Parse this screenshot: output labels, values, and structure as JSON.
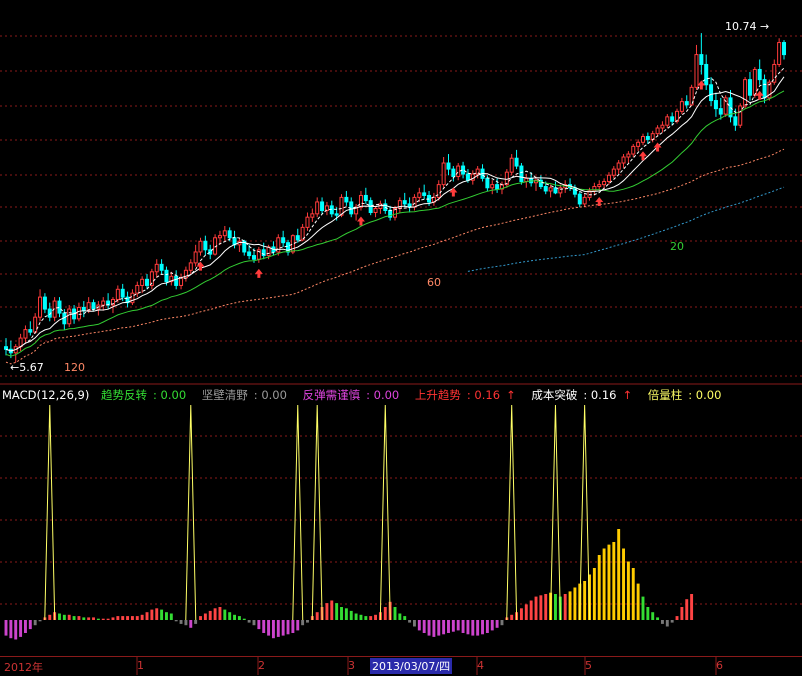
{
  "legend": {
    "title": "MACD(12,26,9)",
    "items": [
      {
        "label": "趋势反转",
        "value": "0.00",
        "color": "#33dd33",
        "arrow": ""
      },
      {
        "label": "坚壁清野",
        "value": "0.00",
        "color": "#9a9a9a",
        "arrow": ""
      },
      {
        "label": "反弹需谨慎",
        "value": "0.00",
        "color": "#dd44dd",
        "arrow": ""
      },
      {
        "label": "上升趋势",
        "value": "0.16",
        "color": "#ff3333",
        "arrow": "↑"
      },
      {
        "label": "成本突破",
        "value": "0.16",
        "color": "#ffffff",
        "arrow": "↑"
      },
      {
        "label": "倍量柱",
        "value": "0.00",
        "color": "#ffff66",
        "arrow": ""
      }
    ]
  },
  "price_labels": {
    "high": "10.74",
    "low": "5.67"
  },
  "ma_labels": {
    "ma20": "20",
    "ma60": "60",
    "ma120": "120"
  },
  "x_axis": {
    "labels": [
      "2012年",
      "1",
      "2",
      "3",
      "4",
      "5",
      "6"
    ],
    "selected_date": "2013/03/07/四"
  },
  "colors": {
    "up": "#ff3b3b",
    "down": "#00ffff",
    "ma5": "#ffffff",
    "ma10": "#ffffff",
    "ma20": "#33cc33",
    "ma60": "#ff8866",
    "ma120": "#3399cc",
    "spike": "#ffff66",
    "hist_red": "#ff4444",
    "hist_green": "#33dd33",
    "hist_gold": "#ffcc00",
    "hist_purple": "#cc44cc",
    "hist_gray": "#777777",
    "grid": "#8a1a1a"
  },
  "chart_data": {
    "type": "candlestick",
    "price_scale": "log",
    "price_range": [
      5.5,
      11.4
    ],
    "candles": [
      [
        5.85,
        5.95,
        5.75,
        5.82
      ],
      [
        5.82,
        5.92,
        5.72,
        5.78
      ],
      [
        5.78,
        5.88,
        5.67,
        5.85
      ],
      [
        5.85,
        6.0,
        5.8,
        5.95
      ],
      [
        5.95,
        6.1,
        5.9,
        6.05
      ],
      [
        6.05,
        6.15,
        5.98,
        6.02
      ],
      [
        6.02,
        6.25,
        6.0,
        6.2
      ],
      [
        6.2,
        6.55,
        6.15,
        6.45
      ],
      [
        6.45,
        6.5,
        6.25,
        6.3
      ],
      [
        6.3,
        6.38,
        6.15,
        6.2
      ],
      [
        6.2,
        6.45,
        6.15,
        6.4
      ],
      [
        6.4,
        6.45,
        6.2,
        6.25
      ],
      [
        6.25,
        6.3,
        6.05,
        6.12
      ],
      [
        6.12,
        6.35,
        6.08,
        6.3
      ],
      [
        6.3,
        6.35,
        6.12,
        6.18
      ],
      [
        6.18,
        6.38,
        6.15,
        6.32
      ],
      [
        6.32,
        6.4,
        6.2,
        6.28
      ],
      [
        6.28,
        6.45,
        6.25,
        6.38
      ],
      [
        6.38,
        6.42,
        6.28,
        6.3
      ],
      [
        6.3,
        6.4,
        6.22,
        6.35
      ],
      [
        6.35,
        6.45,
        6.28,
        6.4
      ],
      [
        6.4,
        6.5,
        6.3,
        6.35
      ],
      [
        6.35,
        6.45,
        6.25,
        6.42
      ],
      [
        6.42,
        6.6,
        6.38,
        6.55
      ],
      [
        6.55,
        6.62,
        6.4,
        6.45
      ],
      [
        6.45,
        6.52,
        6.32,
        6.38
      ],
      [
        6.38,
        6.55,
        6.35,
        6.5
      ],
      [
        6.5,
        6.65,
        6.45,
        6.6
      ],
      [
        6.6,
        6.72,
        6.5,
        6.68
      ],
      [
        6.68,
        6.75,
        6.55,
        6.6
      ],
      [
        6.6,
        6.82,
        6.55,
        6.78
      ],
      [
        6.78,
        6.95,
        6.7,
        6.88
      ],
      [
        6.88,
        6.95,
        6.75,
        6.8
      ],
      [
        6.8,
        6.85,
        6.6,
        6.65
      ],
      [
        6.65,
        6.78,
        6.6,
        6.72
      ],
      [
        6.72,
        6.8,
        6.55,
        6.6
      ],
      [
        6.6,
        6.75,
        6.55,
        6.7
      ],
      [
        6.7,
        6.85,
        6.65,
        6.8
      ],
      [
        6.8,
        6.95,
        6.75,
        6.9
      ],
      [
        6.9,
        7.15,
        6.85,
        7.05
      ],
      [
        7.05,
        7.25,
        7.0,
        7.2
      ],
      [
        7.2,
        7.28,
        7.0,
        7.08
      ],
      [
        7.08,
        7.15,
        6.95,
        7.02
      ],
      [
        7.02,
        7.3,
        7.0,
        7.25
      ],
      [
        7.25,
        7.35,
        7.15,
        7.28
      ],
      [
        7.28,
        7.42,
        7.2,
        7.35
      ],
      [
        7.35,
        7.4,
        7.2,
        7.25
      ],
      [
        7.25,
        7.35,
        7.1,
        7.15
      ],
      [
        7.15,
        7.25,
        7.05,
        7.2
      ],
      [
        7.2,
        7.22,
        7.0,
        7.05
      ],
      [
        7.05,
        7.15,
        6.95,
        7.0
      ],
      [
        7.0,
        7.1,
        6.9,
        6.95
      ],
      [
        6.95,
        7.12,
        6.9,
        7.08
      ],
      [
        7.08,
        7.18,
        6.95,
        7.0
      ],
      [
        7.0,
        7.15,
        6.95,
        7.12
      ],
      [
        7.12,
        7.2,
        7.0,
        7.05
      ],
      [
        7.05,
        7.3,
        7.0,
        7.25
      ],
      [
        7.25,
        7.35,
        7.12,
        7.18
      ],
      [
        7.18,
        7.22,
        7.0,
        7.05
      ],
      [
        7.05,
        7.3,
        7.02,
        7.28
      ],
      [
        7.28,
        7.38,
        7.18,
        7.22
      ],
      [
        7.22,
        7.45,
        7.2,
        7.4
      ],
      [
        7.4,
        7.62,
        7.35,
        7.55
      ],
      [
        7.55,
        7.68,
        7.48,
        7.6
      ],
      [
        7.6,
        7.85,
        7.55,
        7.78
      ],
      [
        7.78,
        7.85,
        7.6,
        7.65
      ],
      [
        7.65,
        7.78,
        7.58,
        7.72
      ],
      [
        7.72,
        7.8,
        7.55,
        7.6
      ],
      [
        7.6,
        7.7,
        7.5,
        7.58
      ],
      [
        7.58,
        7.9,
        7.55,
        7.85
      ],
      [
        7.85,
        7.95,
        7.72,
        7.78
      ],
      [
        7.78,
        7.85,
        7.55,
        7.6
      ],
      [
        7.6,
        7.75,
        7.5,
        7.7
      ],
      [
        7.7,
        7.95,
        7.65,
        7.88
      ],
      [
        7.88,
        8.0,
        7.75,
        7.8
      ],
      [
        7.8,
        7.85,
        7.58,
        7.62
      ],
      [
        7.62,
        7.72,
        7.55,
        7.68
      ],
      [
        7.68,
        7.8,
        7.6,
        7.75
      ],
      [
        7.75,
        7.82,
        7.6,
        7.65
      ],
      [
        7.65,
        7.72,
        7.5,
        7.55
      ],
      [
        7.55,
        7.72,
        7.5,
        7.68
      ],
      [
        7.68,
        7.85,
        7.62,
        7.8
      ],
      [
        7.8,
        7.92,
        7.7,
        7.75
      ],
      [
        7.75,
        7.85,
        7.62,
        7.7
      ],
      [
        7.7,
        7.9,
        7.65,
        7.85
      ],
      [
        7.85,
        8.0,
        7.78,
        7.92
      ],
      [
        7.92,
        8.05,
        7.82,
        7.88
      ],
      [
        7.88,
        7.95,
        7.72,
        7.78
      ],
      [
        7.78,
        7.92,
        7.72,
        7.85
      ],
      [
        7.85,
        8.12,
        7.8,
        8.05
      ],
      [
        8.05,
        8.5,
        8.0,
        8.4
      ],
      [
        8.4,
        8.55,
        8.2,
        8.3
      ],
      [
        8.3,
        8.35,
        8.1,
        8.18
      ],
      [
        8.18,
        8.4,
        8.12,
        8.35
      ],
      [
        8.35,
        8.42,
        8.15,
        8.22
      ],
      [
        8.22,
        8.3,
        8.08,
        8.12
      ],
      [
        8.12,
        8.28,
        8.05,
        8.22
      ],
      [
        8.22,
        8.35,
        8.15,
        8.3
      ],
      [
        8.3,
        8.38,
        8.1,
        8.15
      ],
      [
        8.15,
        8.2,
        7.95,
        8.0
      ],
      [
        8.0,
        8.12,
        7.9,
        8.05
      ],
      [
        8.05,
        8.15,
        7.92,
        7.98
      ],
      [
        7.98,
        8.1,
        7.9,
        8.05
      ],
      [
        8.05,
        8.3,
        8.0,
        8.25
      ],
      [
        8.25,
        8.55,
        8.2,
        8.48
      ],
      [
        8.48,
        8.62,
        8.3,
        8.35
      ],
      [
        8.35,
        8.4,
        8.05,
        8.1
      ],
      [
        8.1,
        8.22,
        8.0,
        8.15
      ],
      [
        8.15,
        8.25,
        8.02,
        8.08
      ],
      [
        8.08,
        8.18,
        7.95,
        8.12
      ],
      [
        8.12,
        8.2,
        7.98,
        8.02
      ],
      [
        8.02,
        8.1,
        7.9,
        7.95
      ],
      [
        7.95,
        8.05,
        7.85,
        8.0
      ],
      [
        8.0,
        8.1,
        7.9,
        7.92
      ],
      [
        7.92,
        8.05,
        7.85,
        8.0
      ],
      [
        8.0,
        8.12,
        7.92,
        8.05
      ],
      [
        8.05,
        8.15,
        7.95,
        8.0
      ],
      [
        8.0,
        8.05,
        7.85,
        7.9
      ],
      [
        7.9,
        7.95,
        7.7,
        7.75
      ],
      [
        7.75,
        7.9,
        7.7,
        7.85
      ],
      [
        7.85,
        8.0,
        7.8,
        7.95
      ],
      [
        7.95,
        8.08,
        7.88,
        8.02
      ],
      [
        8.02,
        8.12,
        7.95,
        8.05
      ],
      [
        8.05,
        8.15,
        7.98,
        8.1
      ],
      [
        8.1,
        8.25,
        8.05,
        8.2
      ],
      [
        8.2,
        8.35,
        8.15,
        8.3
      ],
      [
        8.3,
        8.45,
        8.22,
        8.4
      ],
      [
        8.4,
        8.55,
        8.32,
        8.5
      ],
      [
        8.5,
        8.6,
        8.4,
        8.55
      ],
      [
        8.55,
        8.72,
        8.5,
        8.68
      ],
      [
        8.68,
        8.8,
        8.6,
        8.75
      ],
      [
        8.75,
        8.9,
        8.7,
        8.85
      ],
      [
        8.85,
        8.92,
        8.72,
        8.8
      ],
      [
        8.8,
        8.95,
        8.75,
        8.9
      ],
      [
        8.9,
        9.05,
        8.85,
        9.0
      ],
      [
        9.0,
        9.12,
        8.92,
        9.05
      ],
      [
        9.05,
        9.25,
        9.0,
        9.2
      ],
      [
        9.2,
        9.28,
        9.05,
        9.12
      ],
      [
        9.12,
        9.35,
        9.08,
        9.3
      ],
      [
        9.3,
        9.55,
        9.25,
        9.48
      ],
      [
        9.48,
        9.6,
        9.35,
        9.42
      ],
      [
        9.42,
        9.8,
        9.4,
        9.75
      ],
      [
        9.75,
        10.6,
        9.7,
        10.4
      ],
      [
        10.4,
        10.85,
        10.0,
        10.2
      ],
      [
        10.2,
        10.4,
        9.7,
        9.8
      ],
      [
        9.8,
        9.95,
        9.4,
        9.5
      ],
      [
        9.5,
        9.65,
        9.2,
        9.35
      ],
      [
        9.35,
        9.55,
        9.15,
        9.25
      ],
      [
        9.25,
        9.6,
        9.2,
        9.55
      ],
      [
        9.55,
        9.7,
        9.1,
        9.2
      ],
      [
        9.2,
        9.35,
        8.95,
        9.05
      ],
      [
        9.05,
        9.45,
        9.0,
        9.4
      ],
      [
        9.4,
        9.95,
        9.35,
        9.9
      ],
      [
        9.9,
        10.05,
        9.5,
        9.6
      ],
      [
        9.6,
        10.15,
        9.55,
        10.1
      ],
      [
        10.1,
        10.3,
        9.8,
        9.9
      ],
      [
        9.9,
        10.0,
        9.45,
        9.55
      ],
      [
        9.55,
        9.9,
        9.5,
        9.85
      ],
      [
        9.85,
        10.3,
        9.8,
        10.2
      ],
      [
        10.2,
        10.74,
        10.15,
        10.65
      ],
      [
        10.65,
        10.7,
        10.3,
        10.4
      ]
    ],
    "ma_lines": [
      {
        "name": "ma20",
        "label": "20"
      },
      {
        "name": "ma60",
        "label": "60"
      },
      {
        "name": "ma120",
        "label": "120"
      }
    ],
    "macd_histogram": [
      -0.012,
      -0.014,
      -0.015,
      -0.013,
      -0.01,
      -0.007,
      -0.004,
      -0.001,
      0.002,
      0.004,
      0.006,
      0.005,
      0.004,
      0.004,
      0.003,
      0.003,
      0.002,
      0.002,
      0.002,
      0.001,
      0.001,
      0.001,
      0.002,
      0.003,
      0.003,
      0.003,
      0.003,
      0.003,
      0.004,
      0.006,
      0.008,
      0.009,
      0.008,
      0.006,
      0.005,
      -0.001,
      -0.003,
      -0.004,
      -0.006,
      -0.003,
      0.003,
      0.005,
      0.007,
      0.009,
      0.01,
      0.008,
      0.006,
      0.004,
      0.003,
      0.001,
      -0.002,
      -0.004,
      -0.007,
      -0.01,
      -0.012,
      -0.014,
      -0.013,
      -0.012,
      -0.011,
      -0.01,
      -0.008,
      -0.004,
      -0.002,
      0.003,
      0.006,
      0.01,
      0.013,
      0.015,
      0.013,
      0.01,
      0.009,
      0.007,
      0.005,
      0.004,
      0.003,
      0.003,
      0.004,
      0.006,
      0.01,
      0.014,
      0.01,
      0.005,
      0.003,
      -0.002,
      -0.005,
      -0.008,
      -0.01,
      -0.012,
      -0.013,
      -0.012,
      -0.011,
      -0.01,
      -0.009,
      -0.008,
      -0.01,
      -0.011,
      -0.012,
      -0.012,
      -0.011,
      -0.01,
      -0.008,
      -0.006,
      -0.004,
      0.002,
      0.004,
      0.006,
      0.009,
      0.012,
      0.015,
      0.018,
      0.019,
      0.02,
      0.021,
      0.02,
      0.018,
      0.02,
      0.022,
      0.025,
      0.028,
      0.03,
      0.035,
      0.04,
      0.05,
      0.055,
      0.058,
      0.06,
      0.07,
      0.055,
      0.045,
      0.04,
      0.028,
      0.018,
      0.01,
      0.006,
      0.002,
      -0.003,
      -0.005,
      -0.002,
      0.003,
      0.01,
      0.016,
      0.02
    ],
    "signal_spikes": [
      9,
      38,
      60,
      64,
      78,
      104,
      113,
      119
    ]
  }
}
